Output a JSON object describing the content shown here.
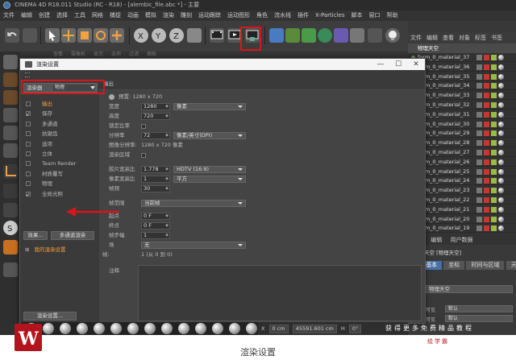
{
  "app": {
    "title": "CINEMA 4D R18.011 Studio (RC - R18) - [alembic_file.abc *] - 主要",
    "menus": [
      "文件",
      "编辑",
      "创建",
      "选择",
      "工具",
      "网格",
      "捕捉",
      "动画",
      "模拟",
      "渲染",
      "雕刻",
      "运动跟踪",
      "运动图形",
      "角色",
      "流水线",
      "插件",
      "X-Particles",
      "脚本",
      "窗口",
      "帮助"
    ]
  },
  "viewport": {
    "tabs": [
      "查看",
      "摄像机",
      "显示",
      "选项",
      "过滤",
      "面板"
    ]
  },
  "object_manager": {
    "header_tabs": [
      "文件",
      "编辑",
      "查看",
      "对象",
      "标签",
      "书签"
    ],
    "top_item": "物理天空",
    "items": [
      "form_0_material_37",
      "form_0_material_36",
      "form_0_material_35",
      "form_0_material_34",
      "form_0_material_33",
      "form_0_material_32",
      "form_0_material_31",
      "form_0_material_30",
      "form_0_material_29",
      "form_0_material_28",
      "form_0_material_27",
      "form_0_material_26",
      "form_0_material_25",
      "form_0_material_24",
      "form_0_material_23",
      "form_0_material_22",
      "form_0_material_21",
      "form_0_material_20",
      "form_0_material_19"
    ]
  },
  "attribute_manager": {
    "menu": [
      "模式",
      "编辑",
      "用户数据"
    ],
    "object_label": "天空 [物理天空]",
    "tabs": [
      "基本",
      "坐标",
      "时间与区域",
      "天空"
    ],
    "fields": [
      {
        "label": "名称",
        "value": "物理天空"
      },
      {
        "label": "编辑器可见",
        "value": "默认"
      },
      {
        "label": "渲染器可见",
        "value": "默认"
      }
    ]
  },
  "dialog": {
    "title": "渲染设置",
    "renderer_label": "渲染器",
    "renderer_value": "物理",
    "nav": [
      {
        "label": "输出",
        "check": false,
        "selected": true,
        "expander": false
      },
      {
        "label": "保存",
        "check": true,
        "selected": false,
        "expander": false
      },
      {
        "label": "多通道",
        "check": false,
        "selected": false,
        "expander": false
      },
      {
        "label": "抗锯齿",
        "check": false,
        "selected": false,
        "expander": false
      },
      {
        "label": "选项",
        "check": false,
        "selected": false,
        "expander": false
      },
      {
        "label": "立体",
        "check": false,
        "selected": false,
        "expander": false
      },
      {
        "label": "Team Render",
        "check": false,
        "selected": false,
        "expander": false
      },
      {
        "label": "材质覆写",
        "check": false,
        "selected": false,
        "expander": false
      },
      {
        "label": "物理",
        "check": false,
        "selected": false,
        "expander": false
      },
      {
        "label": "全局光照",
        "check": true,
        "selected": false,
        "expander": false
      }
    ],
    "effects_button": "效果...",
    "multipass_button": "多通道渲染",
    "settings_item": "我的渲染设置",
    "render_settings_button": "渲染设置...",
    "pane_title": "输出",
    "preset": "预置: 1280 x 720",
    "fields": {
      "width_label": "宽度",
      "width_value": "1280",
      "width_unit": "像素",
      "height_label": "高度",
      "height_value": "720",
      "lock_ratio_label": "锁定比率",
      "adjust_res_label": "分辨率",
      "resolution_value": "72",
      "resolution_unit": "像素/英寸(DPI)",
      "image_res_label": "图像分辨率:",
      "image_res_value": "1280 x 720 像素",
      "render_region_label": "渲染区域",
      "film_aspect_label": "胶片宽高比",
      "film_aspect_value": "1.778",
      "film_aspect_preset": "HDTV (16:9)",
      "pixel_aspect_label": "像素宽高比",
      "pixel_aspect_value": "1",
      "pixel_aspect_preset": "平方",
      "fps_label": "帧频",
      "fps_value": "30",
      "frame_range_label": "帧范围",
      "frame_range_value": "当前帧",
      "start_label": "起点",
      "start_value": "0 F",
      "end_label": "终点",
      "end_value": "0 F",
      "frame_step_label": "帧步幅",
      "frame_step_value": "1",
      "fields_label": "场",
      "fields_value": "无",
      "frames_label": "帧:",
      "frames_value": "1 (从 0 到 0)",
      "notes_label": "注释"
    },
    "window_buttons": [
      "—",
      "☐",
      "✕"
    ]
  },
  "coords": {
    "x_label": "X",
    "x_value": "0 cm",
    "y_value": "45591.601 cm",
    "h_label": "H",
    "h_value": "0°"
  },
  "overlay": {
    "promo": "获得更多免费精品教程",
    "site": "绘学霸",
    "logo_letter": "W"
  },
  "caption": "渲染设置",
  "colors": {
    "highlight": "#d9151b",
    "selected_nav": "#f2a040",
    "brand_red": "#b3131c"
  }
}
